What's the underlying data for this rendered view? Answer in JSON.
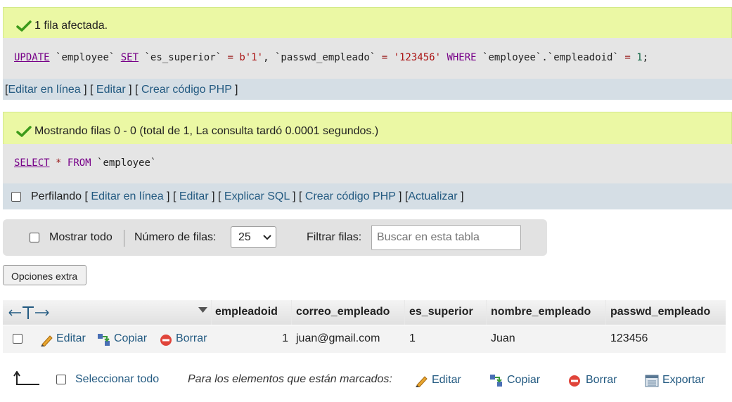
{
  "query1": {
    "message": "1 fila afectada.",
    "sql": {
      "kw_update": "UPDATE",
      "tbl": "`employee`",
      "kw_set": "SET",
      "col1": "`es_superior`",
      "eq1": "=",
      "val1": "b'1'",
      "comma": ",",
      "col2": "`passwd_empleado`",
      "eq2": "=",
      "val2": "'123456'",
      "kw_where": "WHERE",
      "where_col": "`employee`.`empleadoid`",
      "eq3": "=",
      "val3": "1",
      "end": ";"
    },
    "links": {
      "open": "[",
      "edit_inline": "Editar en línea",
      "sep1": "] [",
      "edit": "Editar",
      "sep2": "] [",
      "php": "Crear código PHP",
      "close": "]"
    }
  },
  "query2": {
    "message": "Mostrando filas 0 - 0 (total de 1, La consulta tardó 0.0001 segundos.)",
    "sql": {
      "kw_select": "SELECT",
      "star": "*",
      "kw_from": "FROM",
      "tbl": "`employee`"
    },
    "links": {
      "profiling": "Perfilando",
      "open": "[",
      "edit_inline": "Editar en línea",
      "sep1": "] [",
      "edit": "Editar",
      "sep2": "] [",
      "explain": "Explicar SQL",
      "sep3": "] [",
      "php": "Crear código PHP",
      "sep4": "] [",
      "refresh": "Actualizar",
      "close": "]"
    }
  },
  "toolbar": {
    "show_all": "Mostrar todo",
    "rows_label": "Número de filas:",
    "rows_value": "25",
    "filter_label": "Filtrar filas:",
    "filter_placeholder": "Buscar en esta tabla"
  },
  "extra_options": "Opciones extra",
  "table": {
    "columns": [
      "empleadoid",
      "correo_empleado",
      "es_superior",
      "nombre_empleado",
      "passwd_empleado"
    ],
    "rows": [
      {
        "edit": "Editar",
        "copy": "Copiar",
        "delete": "Borrar",
        "cells": [
          "1",
          "juan@gmail.com",
          "1",
          "Juan",
          "123456"
        ]
      }
    ]
  },
  "footer": {
    "select_all": "Seleccionar todo",
    "marked_label": "Para los elementos que están marcados:",
    "edit": "Editar",
    "copy": "Copiar",
    "delete": "Borrar",
    "export": "Exportar"
  },
  "colors": {
    "success_bg": "#ebf8a4",
    "link": "#235a81",
    "sql_bg": "#e5e5e5",
    "linkbar_bg": "#d5dee5"
  }
}
